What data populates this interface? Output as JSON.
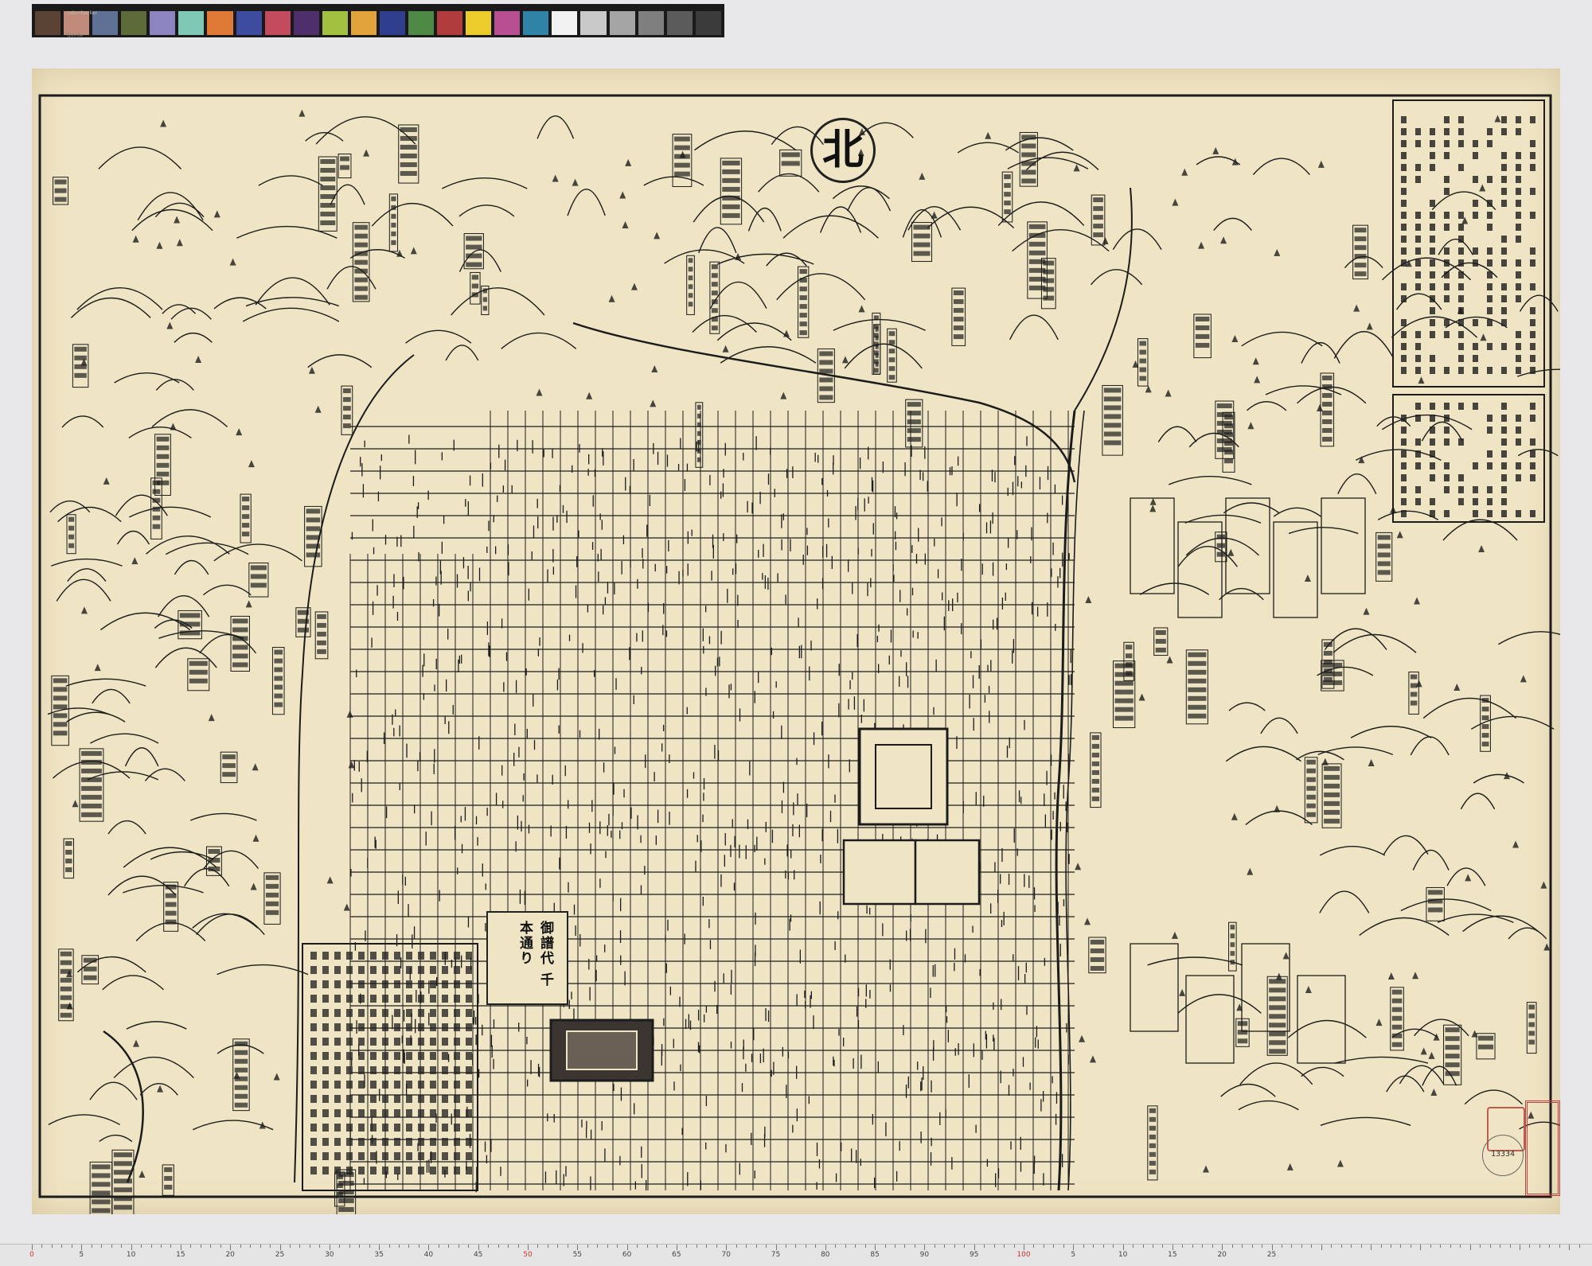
{
  "color_card": {
    "swatches": [
      "#5a4234",
      "#c08c79",
      "#5f7296",
      "#5d6b3a",
      "#8b84c0",
      "#7fc8b4",
      "#de7a35",
      "#3e4ca0",
      "#c44b5d",
      "#4e2f6b",
      "#a3c140",
      "#e3a33b",
      "#2f3f8e",
      "#4e8a45",
      "#b13c3e",
      "#eccc2b",
      "#b84f92",
      "#2f83a6",
      "#f2f2f2",
      "#c9c9c9",
      "#a5a5a5",
      "#7f7f7f",
      "#5b5b5b",
      "#3b3b3b"
    ]
  },
  "map": {
    "north_label": "北",
    "title_text": "御譜代 千本通り",
    "seal_text": "",
    "stamp_number": "13334",
    "paper_color": "#efe4c4",
    "ink_color": "#1c1c1c",
    "seal_color": "#b8413f"
  },
  "ruler": {
    "labels": [
      "0",
      "5",
      "10",
      "15",
      "20",
      "25",
      "30",
      "35",
      "40",
      "45",
      "50",
      "55",
      "60",
      "65",
      "70",
      "75",
      "80",
      "85",
      "90",
      "95",
      "100",
      "5",
      "10",
      "15",
      "20",
      "25"
    ],
    "red_labels": [
      "0",
      "50",
      "100"
    ]
  }
}
